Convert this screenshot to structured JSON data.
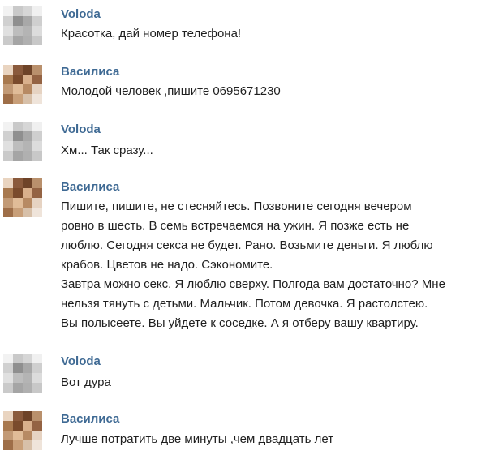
{
  "messages": [
    {
      "author": "Voloda",
      "avatar": "volodya-avatar",
      "lines": [
        "Красотка, дай номер телефона!"
      ]
    },
    {
      "author": "Василиса",
      "avatar": "vasilisa-avatar",
      "lines": [
        "Молодой человек ,пишите 0695671230"
      ]
    },
    {
      "author": "Volоda",
      "avatar": "volodya-avatar",
      "lines": [
        "Хм... Так сразу..."
      ]
    },
    {
      "author": "Василиса",
      "avatar": "vasilisa-avatar",
      "lines": [
        "Пишите, пишите, не стесняйтесь. Позвоните сегодня вечером",
        "ровно в шесть. В семь встречаемся на ужин. Я позже есть не",
        "люблю. Сегодня секса не будет. Рано. Возьмите деньги. Я люблю",
        "крабов. Цветов не надо. Сэкономите.",
        "Завтра можно секс. Я люблю сверху. Полгода вам достаточно? Мне",
        "нельзя тянуть с детьми. Мальчик. Потом девочка. Я растолстею.",
        "Вы полысеете. Вы уйдете к соседке. А я отберу вашу квартиру."
      ]
    },
    {
      "author": "Volоda",
      "avatar": "volodya-avatar",
      "lines": [
        "Вот дура"
      ]
    },
    {
      "author": "Василиса",
      "avatar": "vasilisa-avatar",
      "lines": [
        "Лучше потратить две минуты ,чем двадцать лет"
      ]
    }
  ]
}
